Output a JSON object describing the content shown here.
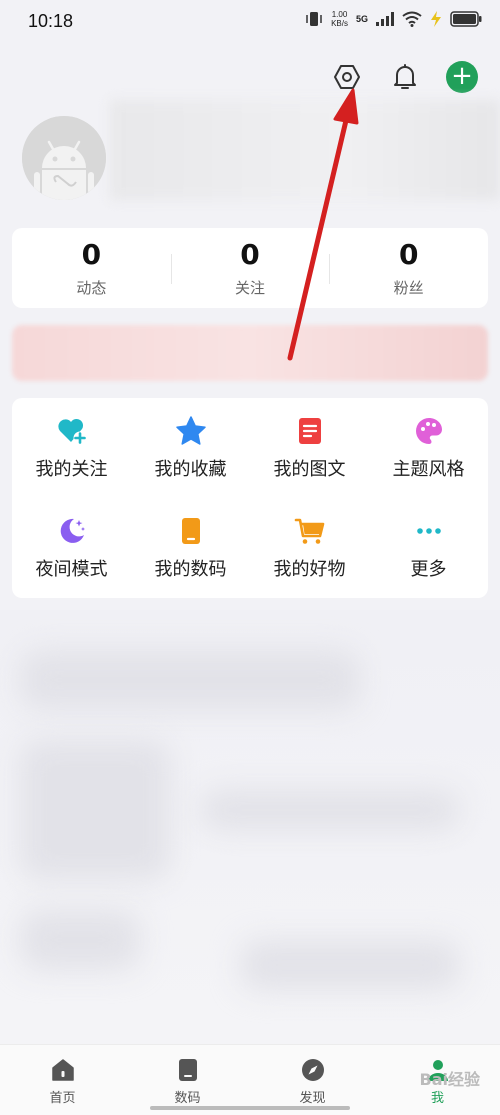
{
  "status_bar": {
    "time": "10:18",
    "speed_value": "1.00",
    "speed_unit": "KB/s",
    "network": "5G"
  },
  "stats": [
    {
      "value": "0",
      "label": "动态"
    },
    {
      "value": "0",
      "label": "关注"
    },
    {
      "value": "0",
      "label": "粉丝"
    }
  ],
  "menu": [
    {
      "label": "我的关注",
      "icon": "heart-plus-icon",
      "color": "#20b8c8"
    },
    {
      "label": "我的收藏",
      "icon": "star-icon",
      "color": "#2f88f0"
    },
    {
      "label": "我的图文",
      "icon": "document-icon",
      "color": "#ee4040"
    },
    {
      "label": "主题风格",
      "icon": "palette-icon",
      "color": "#e060d8"
    },
    {
      "label": "夜间模式",
      "icon": "moon-icon",
      "color": "#8a5ef0"
    },
    {
      "label": "我的数码",
      "icon": "phone-icon",
      "color": "#f29a18"
    },
    {
      "label": "我的好物",
      "icon": "cart-icon",
      "color": "#f29a18"
    },
    {
      "label": "更多",
      "icon": "more-icon",
      "color": "#20b8c8"
    }
  ],
  "tabs": [
    {
      "label": "首页",
      "icon": "home-icon",
      "active": false
    },
    {
      "label": "数码",
      "icon": "device-icon",
      "active": false
    },
    {
      "label": "发现",
      "icon": "compass-icon",
      "active": false
    },
    {
      "label": "我",
      "icon": "profile-icon",
      "active": true
    }
  ],
  "watermark": "Bai经验",
  "colors": {
    "accent": "#21a05a",
    "arrow": "#d42020"
  }
}
